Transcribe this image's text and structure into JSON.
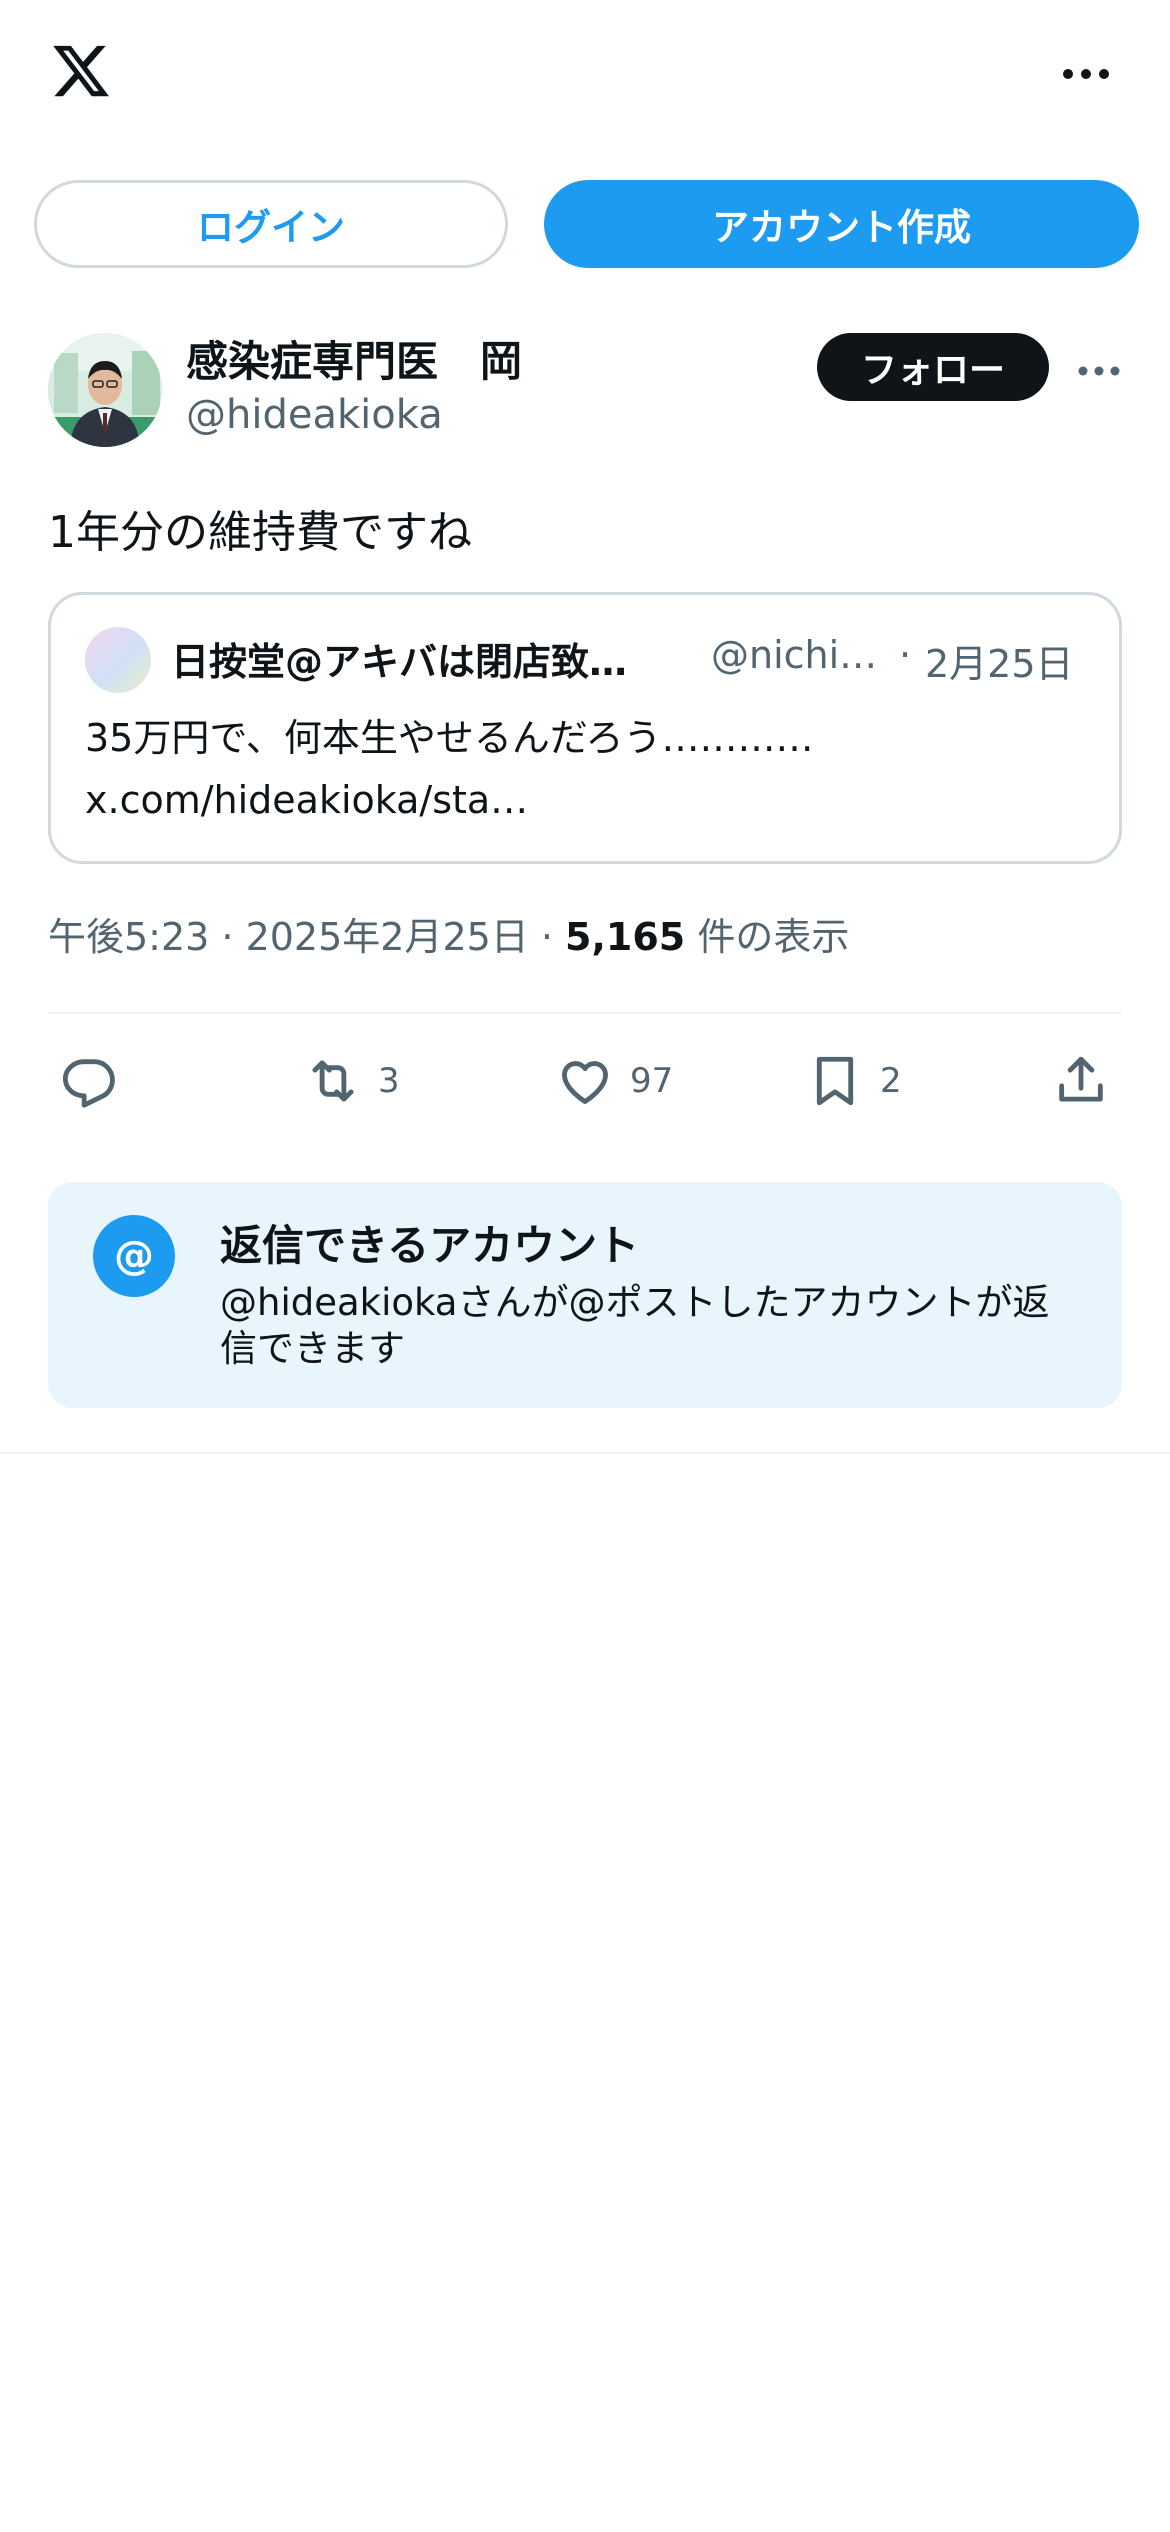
{
  "header": {
    "logo_icon": "x-logo-icon",
    "more_icon": "more-horizontal-icon",
    "login_label": "ログイン",
    "signup_label": "アカウント作成"
  },
  "tweet": {
    "author_name": "感染症専門医　岡",
    "author_handle": "@hideakioka",
    "follow_label": "フォロー",
    "text": "1年分の維持費ですね",
    "quote": {
      "name": "日按堂@アキバは閉店致…",
      "handle": "@nichi…",
      "separator": "·",
      "date": "2月25日",
      "text_line1": "35万円で、何本生やせるんだろう…………",
      "text_line2": "x.com/hideakioka/sta…"
    },
    "meta": {
      "time_date": "午後5:23 · 2025年2月25日 · ",
      "views": "5,165",
      "views_label": " 件の表示"
    },
    "actions": {
      "reply_count": "",
      "retweet_count": "3",
      "like_count": "97",
      "bookmark_count": "2"
    }
  },
  "reply_notice": {
    "icon_text": "@",
    "title": "返信できるアカウント",
    "description": "@hideakiokaさんが@ポストしたアカウントが返信できます"
  },
  "colors": {
    "accent": "#1d9bf0",
    "text": "#0f1419",
    "secondary": "#536471",
    "notice_bg": "#e8f5fd"
  }
}
